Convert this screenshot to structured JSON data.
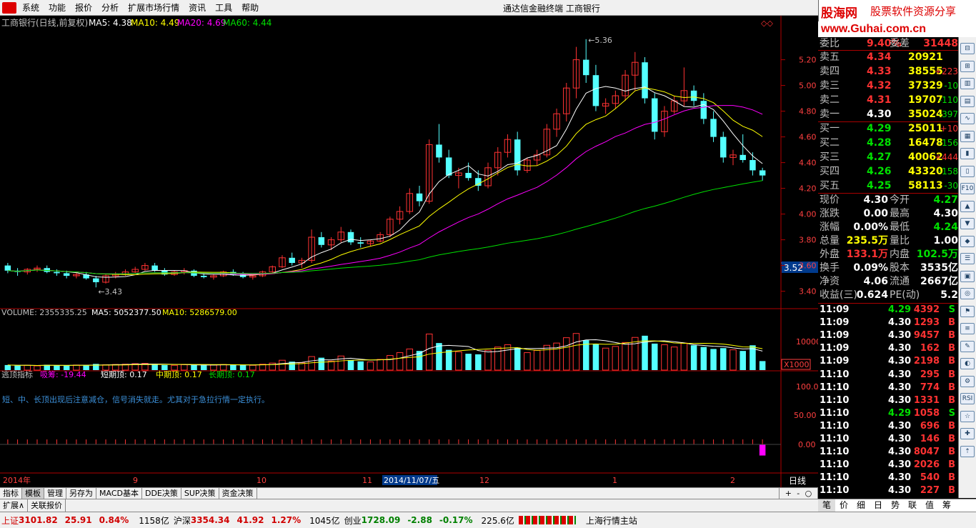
{
  "menu": [
    "系统",
    "功能",
    "报价",
    "分析",
    "扩展市场行情",
    "资讯",
    "工具",
    "帮助"
  ],
  "window_title": "通达信金融终端  工商银行",
  "brand": {
    "cn_left": "股海网",
    "cn_right": "股票软件资源分享",
    "url": "www.Guhai.com.cn"
  },
  "chart": {
    "title": "工商银行(日线,前复权)",
    "ma": [
      {
        "label": "MA5: 4.38",
        "color": "#ffffff"
      },
      {
        "label": "MA10: 4.49",
        "color": "#ffff00"
      },
      {
        "label": "MA20: 4.69",
        "color": "#ff00ff"
      },
      {
        "label": "MA60: 4.44",
        "color": "#00e000"
      }
    ],
    "price_ticks": [
      "5.20",
      "5.00",
      "4.80",
      "4.60",
      "4.40",
      "4.20",
      "4.00",
      "3.80",
      "3.60",
      "3.40"
    ],
    "price_min_label": "3.43",
    "price_max_label": "5.36",
    "cursor_price": "3.52",
    "volume_header": {
      "label": "VOLUME: 2355335.25",
      "ma5": "MA5: 5052377.50",
      "ma10": "MA10: 5286579.00"
    },
    "volume_ticks": [
      "10000"
    ],
    "volume_unit": "X1000",
    "ind_header": {
      "name": "逃顶指标",
      "xichou": "吸筹: -19.44",
      "short": "短期顶: 0.17",
      "mid": "中期顶: 0.17",
      "long": "长期顶: 0.17"
    },
    "ind_note": "短、中、长顶出现后注意减仓，信号消失就走。尤其对于急拉行情一定执行。",
    "ind_ticks": [
      "100.0",
      "50.00",
      "0.00"
    ],
    "x_labels": [
      "2014年",
      "9",
      "10",
      "11",
      "2014/11/07/五",
      "12",
      "1",
      "2"
    ],
    "period": "日线"
  },
  "chart_data": {
    "type": "candlestick",
    "title": "工商银行(日线,前复权)",
    "ylim": [
      3.32,
      5.42
    ],
    "ohlc": [
      [
        3.6,
        3.62,
        3.54,
        3.56
      ],
      [
        3.56,
        3.58,
        3.52,
        3.55
      ],
      [
        3.55,
        3.58,
        3.53,
        3.57
      ],
      [
        3.57,
        3.6,
        3.55,
        3.58
      ],
      [
        3.58,
        3.6,
        3.54,
        3.55
      ],
      [
        3.55,
        3.57,
        3.52,
        3.54
      ],
      [
        3.54,
        3.56,
        3.5,
        3.52
      ],
      [
        3.52,
        3.55,
        3.5,
        3.53
      ],
      [
        3.53,
        3.55,
        3.49,
        3.5
      ],
      [
        3.5,
        3.52,
        3.43,
        3.47
      ],
      [
        3.47,
        3.53,
        3.46,
        3.52
      ],
      [
        3.52,
        3.55,
        3.5,
        3.53
      ],
      [
        3.53,
        3.57,
        3.52,
        3.55
      ],
      [
        3.55,
        3.59,
        3.54,
        3.57
      ],
      [
        3.57,
        3.62,
        3.56,
        3.6
      ],
      [
        3.6,
        3.62,
        3.55,
        3.56
      ],
      [
        3.56,
        3.58,
        3.52,
        3.53
      ],
      [
        3.53,
        3.56,
        3.52,
        3.55
      ],
      [
        3.55,
        3.58,
        3.53,
        3.56
      ],
      [
        3.56,
        3.57,
        3.51,
        3.52
      ],
      [
        3.52,
        3.54,
        3.5,
        3.51
      ],
      [
        3.51,
        3.53,
        3.49,
        3.52
      ],
      [
        3.52,
        3.56,
        3.51,
        3.55
      ],
      [
        3.55,
        3.57,
        3.52,
        3.53
      ],
      [
        3.53,
        3.55,
        3.5,
        3.51
      ],
      [
        3.51,
        3.53,
        3.49,
        3.52
      ],
      [
        3.52,
        3.56,
        3.51,
        3.55
      ],
      [
        3.55,
        3.6,
        3.54,
        3.59
      ],
      [
        3.59,
        3.68,
        3.58,
        3.66
      ],
      [
        3.66,
        3.7,
        3.6,
        3.62
      ],
      [
        3.62,
        3.66,
        3.58,
        3.64
      ],
      [
        3.64,
        3.88,
        3.62,
        3.82
      ],
      [
        3.82,
        3.86,
        3.74,
        3.76
      ],
      [
        3.76,
        3.82,
        3.72,
        3.8
      ],
      [
        3.8,
        3.9,
        3.78,
        3.86
      ],
      [
        3.86,
        3.88,
        3.76,
        3.78
      ],
      [
        3.78,
        3.82,
        3.74,
        3.77
      ],
      [
        3.77,
        3.8,
        3.75,
        3.79
      ],
      [
        3.79,
        3.86,
        3.78,
        3.84
      ],
      [
        3.84,
        3.98,
        3.82,
        3.96
      ],
      [
        3.96,
        4.06,
        3.92,
        4.02
      ],
      [
        4.02,
        4.2,
        4.0,
        4.16
      ],
      [
        4.16,
        4.22,
        4.06,
        4.1
      ],
      [
        4.1,
        4.58,
        4.08,
        4.54
      ],
      [
        4.54,
        4.7,
        4.4,
        4.44
      ],
      [
        4.44,
        4.5,
        4.28,
        4.3
      ],
      [
        4.3,
        4.36,
        4.2,
        4.32
      ],
      [
        4.32,
        4.4,
        4.26,
        4.28
      ],
      [
        4.28,
        4.34,
        4.18,
        4.22
      ],
      [
        4.22,
        4.4,
        4.2,
        4.36
      ],
      [
        4.36,
        4.52,
        4.3,
        4.48
      ],
      [
        4.48,
        4.62,
        4.44,
        4.58
      ],
      [
        4.58,
        4.64,
        4.3,
        4.34
      ],
      [
        4.34,
        4.44,
        4.32,
        4.42
      ],
      [
        4.42,
        4.5,
        4.38,
        4.46
      ],
      [
        4.46,
        4.7,
        4.44,
        4.66
      ],
      [
        4.66,
        4.82,
        4.6,
        4.78
      ],
      [
        4.78,
        5.02,
        4.72,
        4.98
      ],
      [
        4.98,
        5.3,
        4.9,
        5.2
      ],
      [
        5.2,
        5.36,
        5.02,
        5.08
      ],
      [
        5.08,
        5.16,
        4.8,
        4.84
      ],
      [
        4.84,
        4.9,
        4.78,
        4.86
      ],
      [
        4.86,
        4.96,
        4.82,
        4.92
      ],
      [
        4.92,
        5.12,
        4.88,
        5.08
      ],
      [
        5.08,
        5.26,
        4.96,
        5.18
      ],
      [
        5.18,
        5.22,
        4.86,
        4.9
      ],
      [
        4.9,
        4.94,
        4.58,
        4.64
      ],
      [
        4.64,
        4.84,
        4.6,
        4.8
      ],
      [
        4.8,
        4.92,
        4.78,
        4.88
      ],
      [
        4.88,
        5.14,
        4.84,
        4.96
      ],
      [
        4.96,
        5.0,
        4.84,
        4.88
      ],
      [
        4.88,
        4.94,
        4.7,
        4.74
      ],
      [
        4.74,
        4.8,
        4.56,
        4.6
      ],
      [
        4.6,
        4.64,
        4.4,
        4.44
      ],
      [
        4.44,
        4.5,
        4.38,
        4.46
      ],
      [
        4.46,
        4.62,
        4.4,
        4.42
      ],
      [
        4.42,
        4.48,
        4.3,
        4.34
      ],
      [
        4.34,
        4.36,
        4.26,
        4.3
      ]
    ],
    "volume_range": [
      0,
      18000
    ],
    "volumes": [
      1800,
      1600,
      1700,
      1500,
      1900,
      1700,
      1600,
      1800,
      1700,
      2200,
      1900,
      2000,
      2100,
      2300,
      2400,
      2000,
      1800,
      1700,
      1900,
      2000,
      1700,
      1800,
      2000,
      1900,
      1800,
      1700,
      2100,
      2500,
      3500,
      3000,
      2600,
      4800,
      4400,
      3200,
      5000,
      3600,
      3100,
      2900,
      3800,
      5200,
      6200,
      7500,
      6800,
      12800,
      9600,
      7200,
      6500,
      5800,
      5600,
      7000,
      8200,
      9000,
      8000,
      6200,
      7000,
      8800,
      9600,
      11500,
      13000,
      10600,
      9200,
      7800,
      8400,
      9800,
      11600,
      12200,
      9400,
      9000,
      8200,
      9600,
      8800,
      8200,
      7500,
      7800,
      7200,
      6800,
      8800,
      3200
    ],
    "indicator": [
      0,
      0,
      0,
      0,
      0,
      0,
      0,
      0,
      0,
      0,
      0,
      0,
      0,
      0,
      0,
      0,
      0,
      0,
      0,
      0,
      0,
      0,
      0,
      0,
      0,
      0,
      0,
      0,
      0,
      0,
      0,
      0,
      0,
      0,
      0,
      0,
      0,
      0,
      0,
      0,
      0,
      0,
      0,
      0,
      0,
      0,
      0,
      0,
      0,
      0,
      0,
      0,
      0,
      0,
      0,
      0,
      0,
      0,
      0,
      0,
      0,
      0,
      0,
      0,
      0,
      0,
      0,
      0,
      0,
      0,
      0,
      0,
      0,
      0,
      0,
      0,
      0,
      -19.44
    ]
  },
  "quote": {
    "weibi": {
      "label": "委比",
      "value": "9.40%",
      "label2": "委差",
      "value2": "31448"
    },
    "asks": [
      {
        "label": "卖五",
        "price": "4.34",
        "vol": "20921",
        "chg": ""
      },
      {
        "label": "卖四",
        "price": "4.33",
        "vol": "38555",
        "chg": "+223"
      },
      {
        "label": "卖三",
        "price": "4.32",
        "vol": "37329",
        "chg": "-10"
      },
      {
        "label": "卖二",
        "price": "4.31",
        "vol": "19707",
        "chg": "-110"
      },
      {
        "label": "卖一",
        "price": "4.30",
        "vol": "35024",
        "chg": "-397"
      }
    ],
    "bids": [
      {
        "label": "买一",
        "price": "4.29",
        "vol": "25011",
        "chg": "+10"
      },
      {
        "label": "买二",
        "price": "4.28",
        "vol": "16478",
        "chg": "-156"
      },
      {
        "label": "买三",
        "price": "4.27",
        "vol": "40062",
        "chg": "+444"
      },
      {
        "label": "买四",
        "price": "4.26",
        "vol": "43320",
        "chg": "-158"
      },
      {
        "label": "买五",
        "price": "4.25",
        "vol": "58113",
        "chg": "-30"
      }
    ],
    "stats": [
      {
        "l1": "现价",
        "v1": "4.30",
        "l2": "今开",
        "v2": "4.27"
      },
      {
        "l1": "涨跌",
        "v1": "0.00",
        "l2": "最高",
        "v2": "4.30"
      },
      {
        "l1": "涨幅",
        "v1": "0.00%",
        "l2": "最低",
        "v2": "4.24"
      },
      {
        "l1": "总量",
        "v1": "235.5万",
        "l2": "量比",
        "v2": "1.00"
      },
      {
        "l1": "外盘",
        "v1": "133.1万",
        "l2": "内盘",
        "v2": "102.5万"
      },
      {
        "l1": "换手",
        "v1": "0.09%",
        "l2": "股本",
        "v2": "3535亿"
      },
      {
        "l1": "净资",
        "v1": "4.06",
        "l2": "流通",
        "v2": "2667亿"
      },
      {
        "l1": "收益(三)",
        "v1": "0.624",
        "l2": "PE(动)",
        "v2": "5.2"
      }
    ]
  },
  "ticks": [
    {
      "t": "11:09",
      "p": "4.29",
      "v": "4392",
      "s": "S"
    },
    {
      "t": "11:09",
      "p": "4.30",
      "v": "1293",
      "s": "B"
    },
    {
      "t": "11:09",
      "p": "4.30",
      "v": "9457",
      "s": "B"
    },
    {
      "t": "11:09",
      "p": "4.30",
      "v": "162",
      "s": "B"
    },
    {
      "t": "11:09",
      "p": "4.30",
      "v": "2198",
      "s": "B"
    },
    {
      "t": "11:10",
      "p": "4.30",
      "v": "295",
      "s": "B"
    },
    {
      "t": "11:10",
      "p": "4.30",
      "v": "774",
      "s": "B"
    },
    {
      "t": "11:10",
      "p": "4.30",
      "v": "1331",
      "s": "B"
    },
    {
      "t": "11:10",
      "p": "4.29",
      "v": "1058",
      "s": "S"
    },
    {
      "t": "11:10",
      "p": "4.30",
      "v": "696",
      "s": "B"
    },
    {
      "t": "11:10",
      "p": "4.30",
      "v": "146",
      "s": "B"
    },
    {
      "t": "11:10",
      "p": "4.30",
      "v": "8047",
      "s": "B"
    },
    {
      "t": "11:10",
      "p": "4.30",
      "v": "2026",
      "s": "B"
    },
    {
      "t": "11:10",
      "p": "4.30",
      "v": "540",
      "s": "B"
    },
    {
      "t": "11:10",
      "p": "4.30",
      "v": "227",
      "s": "B"
    }
  ],
  "right_tabs": [
    "笔",
    "价",
    "细",
    "日",
    "势",
    "联",
    "值",
    "筹"
  ],
  "bottom_tabs": [
    "指标",
    "模板",
    "管理",
    "另存为",
    "MACD基本",
    "DDE决策",
    "SUP决策",
    "资金决策"
  ],
  "ext_tabs": [
    "扩展∧",
    "关联报价"
  ],
  "zoom_ctrls": [
    "+",
    "-",
    "○"
  ],
  "status": {
    "sh_label": "上证",
    "sh_val": "3101.82",
    "sh_chg": "25.91",
    "sh_pct": "0.84%",
    "sh_amt": "1158亿",
    "hs_label": "沪深",
    "hs_val": "3354.34",
    "hs_chg": "41.92",
    "hs_pct": "1.27%",
    "hs_amt": "1045亿",
    "cy_label": "创业",
    "cy_val": "1728.09",
    "cy_chg": "-2.88",
    "cy_pct": "-0.17%",
    "cy_amt": "225.6亿",
    "station": "上海行情主站"
  },
  "colors": {
    "up": "#ff3232",
    "down": "#54ffff",
    "ma5": "#ffffff",
    "ma10": "#ffff00",
    "ma20": "#ff00ff",
    "ma60": "#00e000",
    "axis": "#b00000",
    "indicator": "#ff00ff"
  }
}
